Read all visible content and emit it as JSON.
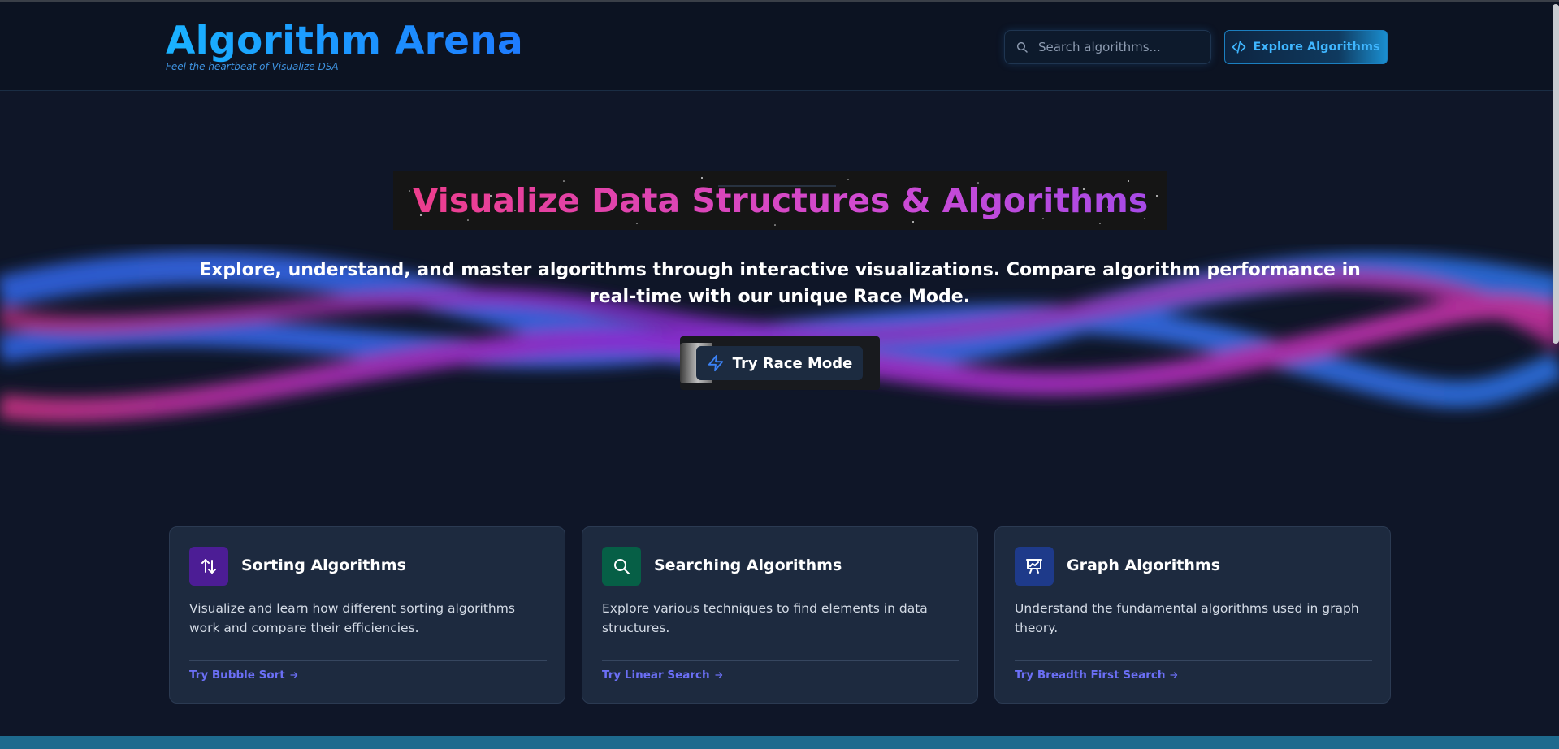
{
  "header": {
    "title": "Algorithm Arena",
    "tagline": "Feel the heartbeat of Visualize DSA",
    "search_placeholder": "Search algorithms...",
    "explore_label": "Explore Algorithms"
  },
  "hero": {
    "title": "Visualize Data Structures & Algorithms",
    "subtitle": "Explore, understand, and master algorithms through interactive visualizations. Compare algorithm performance in real-time with our unique Race Mode.",
    "race_label": "Try Race Mode"
  },
  "cards": [
    {
      "title": "Sorting Algorithms",
      "description": "Visualize and learn how different sorting algorithms work and compare their efficiencies.",
      "link": "Try Bubble Sort",
      "icon": "arrows-up-down-icon",
      "color": "#4c1d95"
    },
    {
      "title": "Searching Algorithms",
      "description": "Explore various techniques to find elements in data structures.",
      "link": "Try Linear Search",
      "icon": "search-icon",
      "color": "#065f46"
    },
    {
      "title": "Graph Algorithms",
      "description": "Understand the fundamental algorithms used in graph theory.",
      "link": "Try Breadth First Search",
      "icon": "presentation-chart-icon",
      "color": "#1e3a8a"
    }
  ],
  "colors": {
    "brand": "#1aa3ff",
    "accent_pink": "#ee3d8a",
    "accent_purple": "#a44ae8",
    "link": "#6b6ff5"
  }
}
